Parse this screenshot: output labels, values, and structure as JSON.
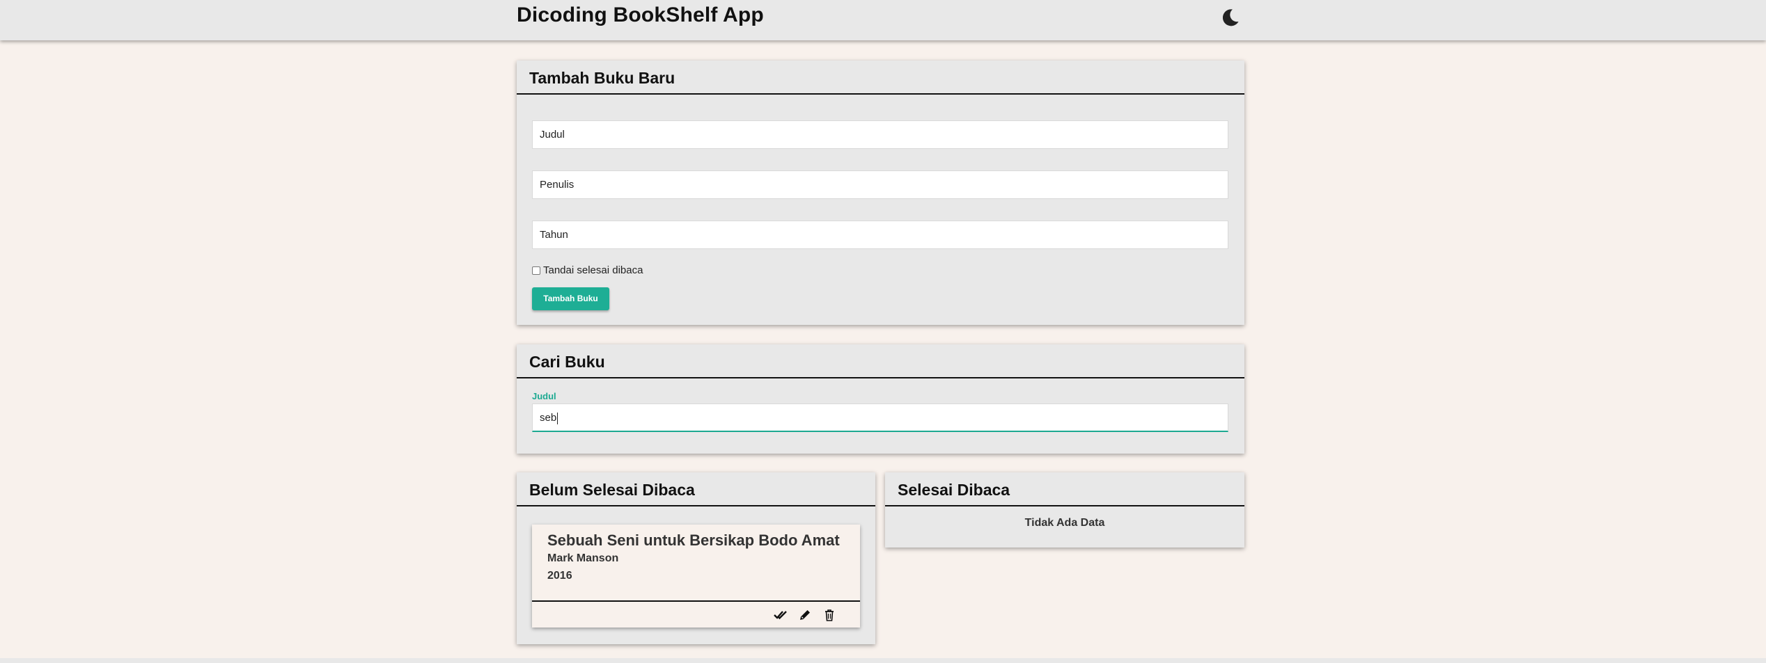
{
  "header": {
    "title": "Dicoding BookShelf App",
    "theme_icon": "moon-icon"
  },
  "add_form": {
    "title": "Tambah Buku Baru",
    "title_placeholder": "Judul",
    "author_placeholder": "Penulis",
    "year_placeholder": "Tahun",
    "checkbox_label": "Tandai selesai dibaca",
    "checkbox_checked": false,
    "submit_label": "Tambah Buku"
  },
  "search": {
    "title": "Cari Buku",
    "field_label": "Judul",
    "value": "seb"
  },
  "unread": {
    "title": "Belum Selesai Dibaca",
    "books": [
      {
        "title": "Sebuah Seni untuk Bersikap Bodo Amat",
        "author": "Mark Manson",
        "year": "2016",
        "actions": [
          "double-check-icon",
          "pencil-icon",
          "trash-icon"
        ]
      }
    ]
  },
  "read": {
    "title": "Selesai Dibaca",
    "empty_text": "Tidak Ada Data"
  },
  "colors": {
    "accent": "#1eae95",
    "background": "#f8f1ec",
    "card": "#e8e8e8"
  }
}
